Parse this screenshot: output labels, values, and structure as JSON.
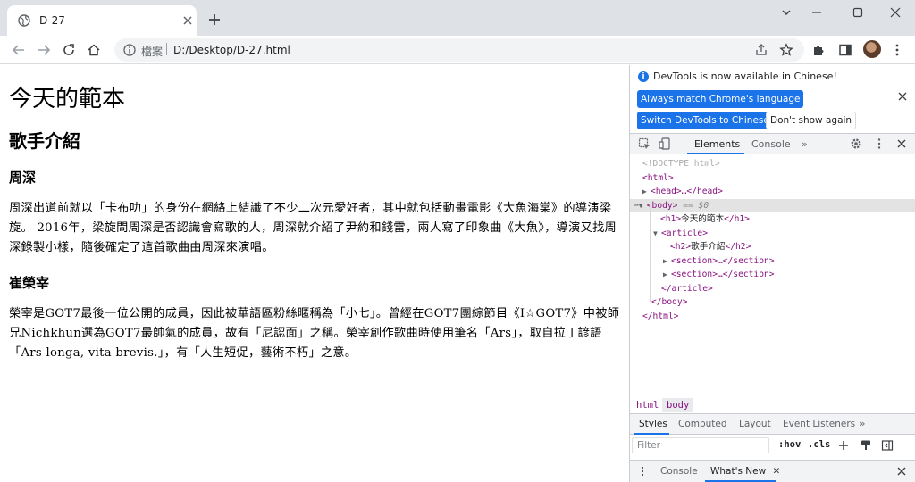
{
  "browser": {
    "tab_title": "D-27",
    "omnibox": {
      "scheme_label": "檔案",
      "url": "D:/Desktop/D-27.html"
    }
  },
  "page": {
    "h1": "今天的範本",
    "h2": "歌手介紹",
    "sections": [
      {
        "heading": "周深",
        "paragraph": "周深出道前就以「卡布叻」的身份在網絡上結識了不少二次元愛好者，其中就包括動畫電影《大魚海棠》的導演梁旋。 2016年，梁旋問周深是否認識會寫歌的人，周深就介紹了尹約和錢雷，兩人寫了印象曲《大魚》，導演又找周深錄製小樣，隨後確定了這首歌曲由周深來演唱。"
      },
      {
        "heading": "崔榮宰",
        "paragraph": "榮宰是GOT7最後一位公開的成員，因此被華語區粉絲暱稱為「小七」。曾經在GOT7團綜節目《I☆GOT7》中被師兄Nichkhun選為GOT7最帥氣的成員，故有「尼認面」之稱。榮宰創作歌曲時使用筆名「Ars」，取自拉丁諺語「Ars longa, vita brevis.」，有「人生短促，藝術不朽」之意。"
      }
    ]
  },
  "devtools": {
    "notice": {
      "text": "DevTools is now available in Chinese!",
      "btn_match": "Always match Chrome's language",
      "btn_switch": "Switch DevTools to Chinese",
      "btn_dont_show": "Don't show again"
    },
    "tabs": {
      "elements": "Elements",
      "console": "Console",
      "more": "»"
    },
    "dom": {
      "doctype": "<!DOCTYPE html>",
      "html_open": "<html>",
      "head": "<head>…</head>",
      "body_open": "<body>",
      "body_selected_marker": "== $0",
      "h1_open": "<h1>",
      "h1_text": "今天的範本",
      "h1_close": "</h1>",
      "article_open": "<article>",
      "h2_open": "<h2>",
      "h2_text": "歌手介紹",
      "h2_close": "</h2>",
      "section_1": "<section>…</section>",
      "section_2": "<section>…</section>",
      "article_close": "</article>",
      "body_close": "</body>",
      "html_close": "</html>"
    },
    "breadcrumbs": [
      "html",
      "body"
    ],
    "style_tabs": [
      "Styles",
      "Computed",
      "Layout",
      "Event Listeners",
      "»"
    ],
    "filter": {
      "placeholder": "Filter",
      "hov": ":hov",
      "cls": ".cls"
    },
    "drawer": {
      "console": "Console",
      "whats_new": "What's New"
    },
    "colors": {
      "accent": "#1a73e8",
      "tag": "#881280"
    }
  }
}
